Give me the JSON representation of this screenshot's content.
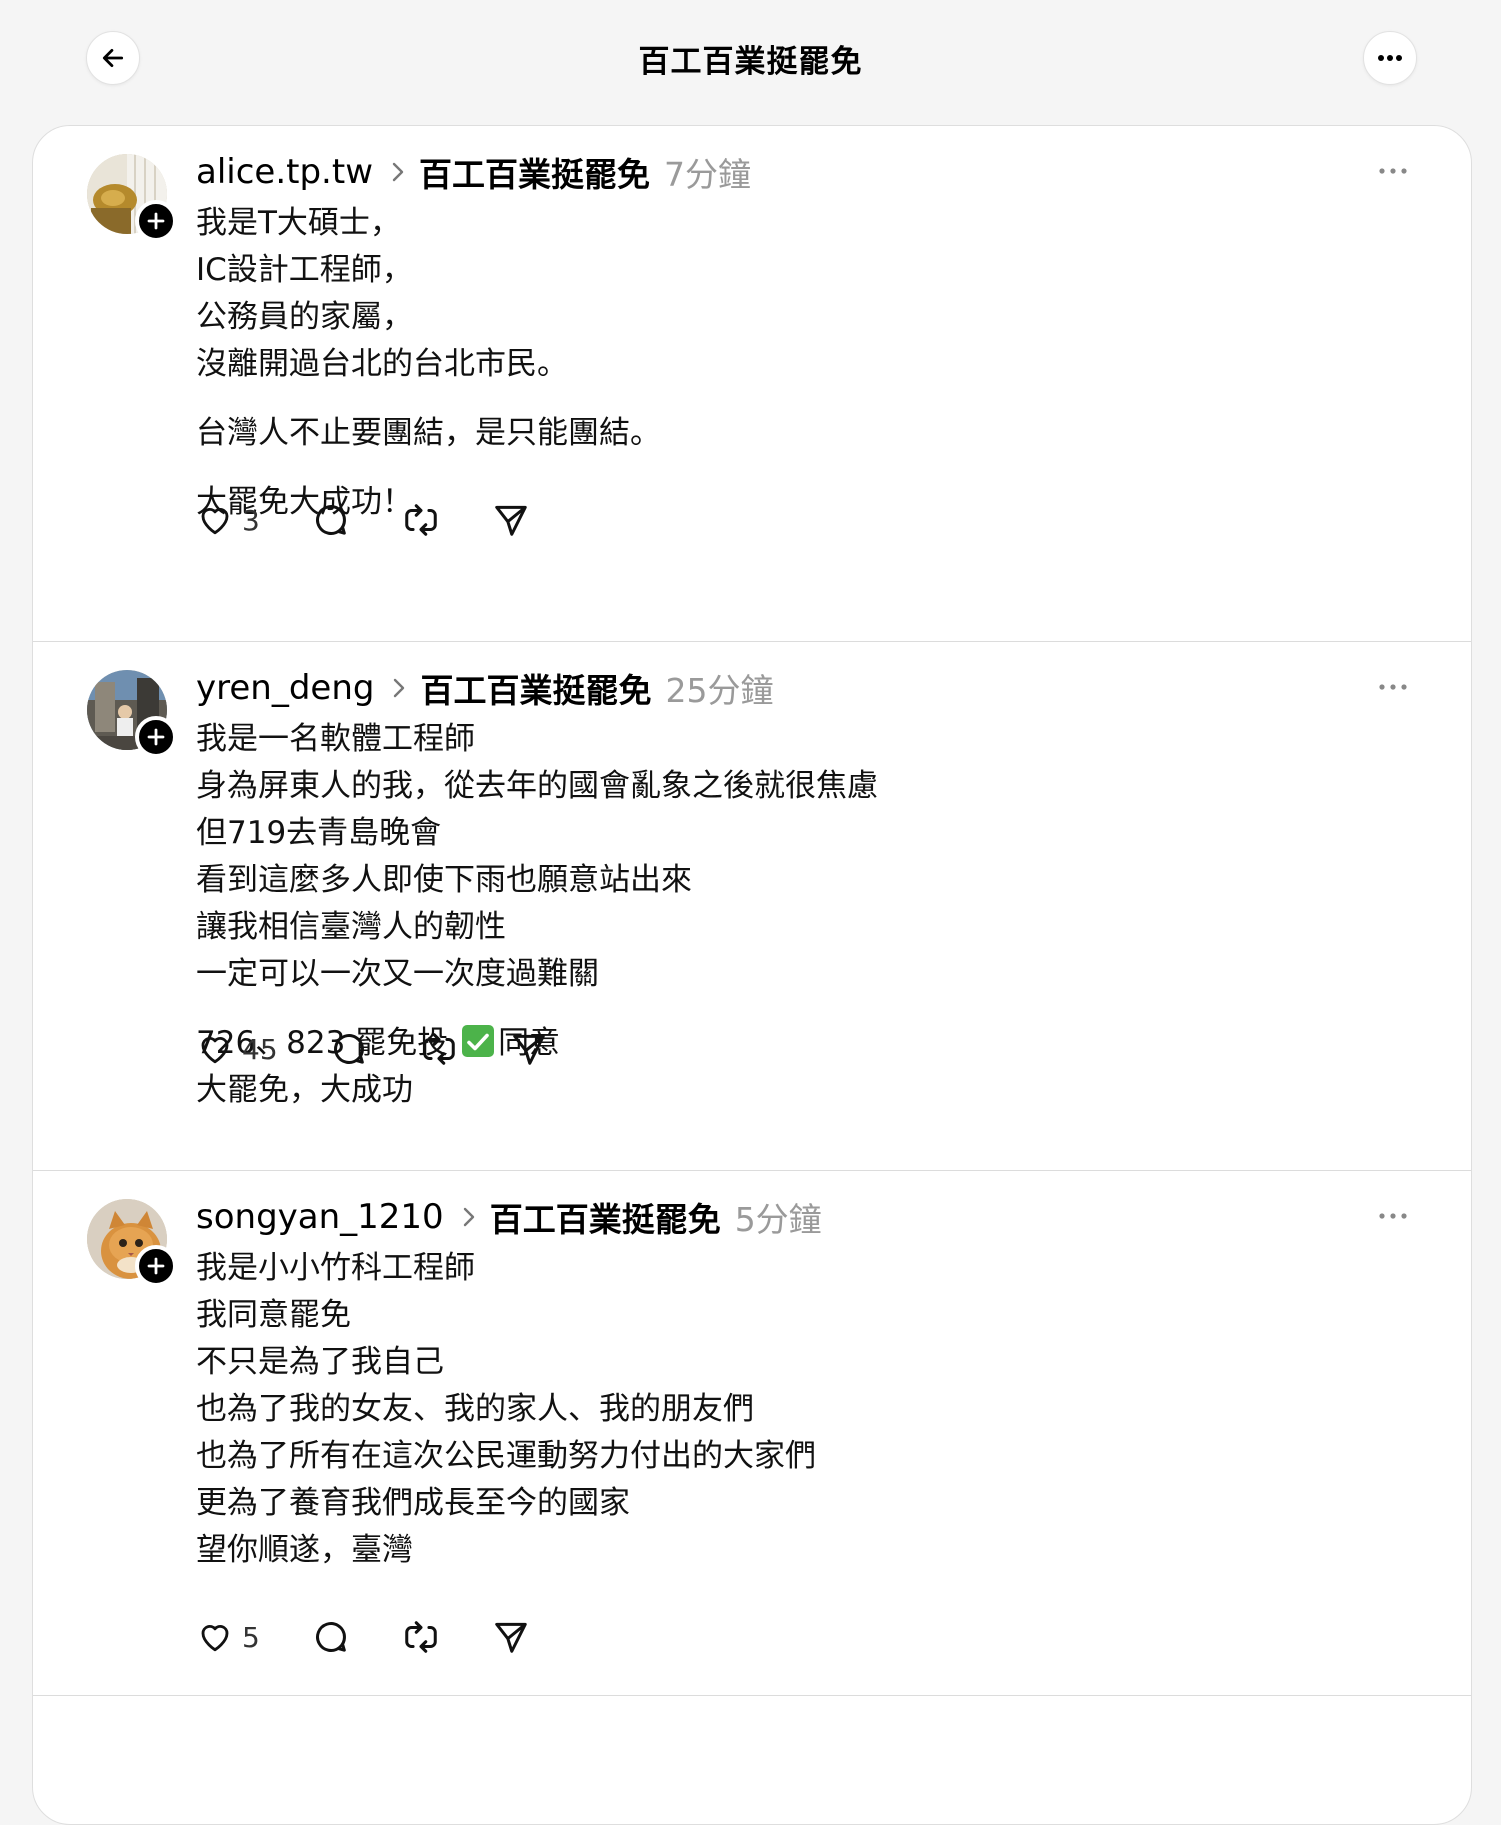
{
  "header": {
    "title": "百工百業挺罷免"
  },
  "posts": [
    {
      "username": "alice.tp.tw",
      "community": "百工百業挺罷免",
      "time": "7分鐘",
      "paragraphs": [
        [
          "我是T大碩士，",
          "IC設計工程師，",
          "公務員的家屬，",
          "沒離開過台北的台北市民。"
        ],
        [
          "台灣人不止要團結，是只能團結。"
        ],
        [
          "大罷免大成功！"
        ]
      ],
      "likes": "3"
    },
    {
      "username": "yren_deng",
      "community": "百工百業挺罷免",
      "time": "25分鐘",
      "paragraphs": [
        [
          "我是一名軟體工程師",
          "身為屏東人的我，從去年的國會亂象之後就很焦慮",
          "但719去青島晚會",
          "看到這麼多人即使下雨也願意站出來",
          "讓我相信臺灣人的韌性",
          "一定可以一次又一次度過難關"
        ],
        [
          "726、823 罷免投",
          "大罷免，大成功"
        ]
      ],
      "vote_prefix": "726、823 罷免投",
      "vote_suffix": "同意",
      "likes": "45"
    },
    {
      "username": "songyan_1210",
      "community": "百工百業挺罷免",
      "time": "5分鐘",
      "paragraphs": [
        [
          "我是小小竹科工程師",
          "我同意罷免",
          "不只是為了我自己",
          "也為了我的女友、我的家人、我的朋友們",
          "也為了所有在這次公民運動努力付出的大家們",
          "更為了養育我們成長至今的國家",
          "望你順遂，臺灣"
        ]
      ],
      "likes": "5"
    }
  ],
  "icons": {
    "back": "arrow-left-icon",
    "more": "more-horizontal-icon",
    "like": "heart-icon",
    "comment": "comment-bubble-icon",
    "repost": "repost-icon",
    "share": "send-icon",
    "follow": "plus-icon"
  },
  "colors": {
    "timestamp": "#9a9a9a",
    "check": "#4cb34a"
  }
}
